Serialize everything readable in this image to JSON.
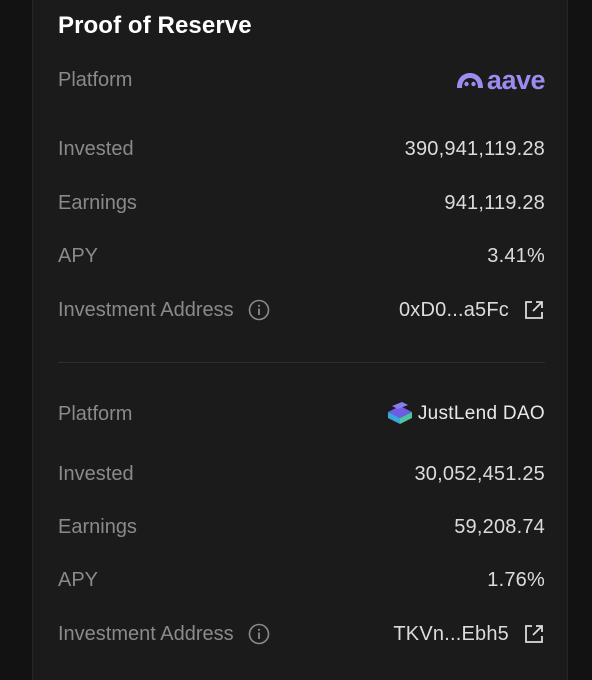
{
  "title": "Proof of Reserve",
  "colors": {
    "background": "#121212",
    "card": "#1b1b1c",
    "label": "#8a8a8a",
    "value": "#dcdcdc",
    "aave_brand": "#9d8cf0",
    "justlend_brand": "#4fc3a1"
  },
  "reserves": [
    {
      "platform_label": "Platform",
      "platform_logo": "aave",
      "platform_logo_icon": "aave-ghost-icon",
      "invested_label": "Invested",
      "invested": "390,941,119.28",
      "earnings_label": "Earnings",
      "earnings": "941,119.28",
      "apy_label": "APY",
      "apy": "3.41%",
      "address_label": "Investment Address",
      "address": "0xD0...a5Fc"
    },
    {
      "platform_label": "Platform",
      "platform_logo": "JustLend DAO",
      "platform_logo_icon": "justlend-cube-icon",
      "invested_label": "Invested",
      "invested": "30,052,451.25",
      "earnings_label": "Earnings",
      "earnings": "59,208.74",
      "apy_label": "APY",
      "apy": "1.76%",
      "address_label": "Investment Address",
      "address": "TKVn...Ebh5"
    }
  ]
}
